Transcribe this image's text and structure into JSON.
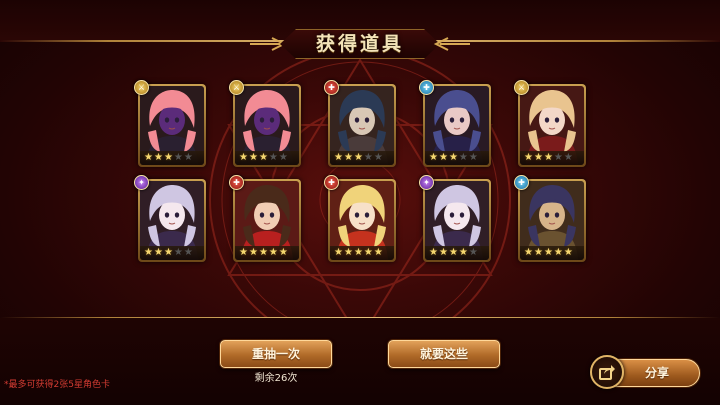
{
  "title": "获得道具",
  "cards": [
    {
      "stars": 3,
      "element": "gold",
      "element_icon": "sword-icon",
      "palette": [
        "#f28b94",
        "#5b2b7a",
        "#2a2030"
      ]
    },
    {
      "stars": 3,
      "element": "gold",
      "element_icon": "sword-icon",
      "palette": [
        "#f28b94",
        "#5b2b7a",
        "#2a2030"
      ]
    },
    {
      "stars": 3,
      "element": "red",
      "element_icon": "cross-icon",
      "palette": [
        "#2b3a55",
        "#d8c7b5",
        "#4a3b3a"
      ]
    },
    {
      "stars": 3,
      "element": "blue",
      "element_icon": "cross-icon",
      "palette": [
        "#4a4e8f",
        "#e9c9c6",
        "#272048"
      ]
    },
    {
      "stars": 3,
      "element": "gold",
      "element_icon": "sword-icon",
      "palette": [
        "#e9c48f",
        "#f3d8c8",
        "#7a1b1b"
      ]
    },
    {
      "stars": 3,
      "element": "purple",
      "element_icon": "star-icon",
      "palette": [
        "#cfc6e2",
        "#f5e8ee",
        "#3b2a4c"
      ]
    },
    {
      "stars": 5,
      "element": "red",
      "element_icon": "cross-icon",
      "palette": [
        "#4a2a1a",
        "#f1cdb4",
        "#b8201f"
      ]
    },
    {
      "stars": 5,
      "element": "red",
      "element_icon": "cross-icon",
      "palette": [
        "#f0d37a",
        "#f7e0c8",
        "#c5321e"
      ]
    },
    {
      "stars": 4,
      "element": "purple",
      "element_icon": "star-icon",
      "palette": [
        "#cfc6e2",
        "#f5e8ee",
        "#3b2a4c"
      ]
    },
    {
      "stars": 5,
      "element": "blue",
      "element_icon": "cross-icon",
      "palette": [
        "#3a3560",
        "#d7b48a",
        "#6a5230"
      ]
    }
  ],
  "buttons": {
    "redraw": "重抽一次",
    "keep": "就要这些",
    "share": "分享"
  },
  "remaining": "剩余26次",
  "note": "*最多可获得2张5星角色卡",
  "colors": {
    "accent_gold": "#e9c27a",
    "note_red": "#d23b32"
  }
}
